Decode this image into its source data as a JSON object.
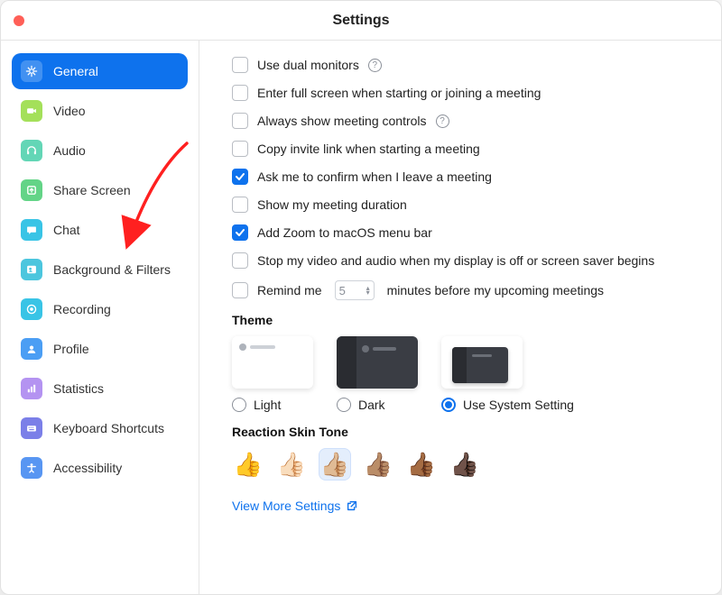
{
  "title": "Settings",
  "sidebar": {
    "items": [
      {
        "label": "General",
        "icon": "gear",
        "color": "#0e72ed",
        "active": true
      },
      {
        "label": "Video",
        "icon": "camera",
        "color": "#a4e05a"
      },
      {
        "label": "Audio",
        "icon": "headset",
        "color": "#63d6b6"
      },
      {
        "label": "Share Screen",
        "icon": "share",
        "color": "#63d487"
      },
      {
        "label": "Chat",
        "icon": "chat",
        "color": "#39c4e6"
      },
      {
        "label": "Background & Filters",
        "icon": "bgfilter",
        "color": "#4cc6de"
      },
      {
        "label": "Recording",
        "icon": "record",
        "color": "#39c4e6"
      },
      {
        "label": "Profile",
        "icon": "profile",
        "color": "#4b9ef4"
      },
      {
        "label": "Statistics",
        "icon": "stats",
        "color": "#b493f1"
      },
      {
        "label": "Keyboard Shortcuts",
        "icon": "keyboard",
        "color": "#7b7fe8"
      },
      {
        "label": "Accessibility",
        "icon": "a11y",
        "color": "#5896f2"
      }
    ]
  },
  "checkboxes": [
    {
      "label": "Use dual monitors",
      "checked": false,
      "help": true
    },
    {
      "label": "Enter full screen when starting or joining a meeting",
      "checked": false
    },
    {
      "label": "Always show meeting controls",
      "checked": false,
      "help": true
    },
    {
      "label": "Copy invite link when starting a meeting",
      "checked": false
    },
    {
      "label": "Ask me to confirm when I leave a meeting",
      "checked": true
    },
    {
      "label": "Show my meeting duration",
      "checked": false
    },
    {
      "label": "Add Zoom to macOS menu bar",
      "checked": true
    },
    {
      "label": "Stop my video and audio when my display is off or screen saver begins",
      "checked": false
    }
  ],
  "remind": {
    "prefix": "Remind me",
    "value": "5",
    "suffix": "minutes before my upcoming meetings",
    "checked": false
  },
  "theme": {
    "heading": "Theme",
    "options": [
      "Light",
      "Dark",
      "Use System Setting"
    ],
    "selected": 2
  },
  "skin": {
    "heading": "Reaction Skin Tone",
    "tones": [
      "👍",
      "👍🏻",
      "👍🏼",
      "👍🏽",
      "👍🏾",
      "👍🏿"
    ],
    "selected": 2
  },
  "more_link": "View More Settings"
}
